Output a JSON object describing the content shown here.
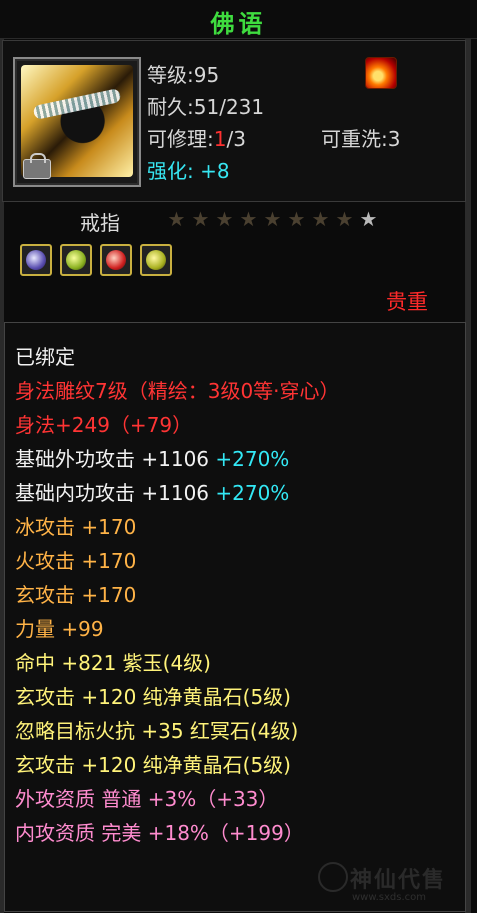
{
  "title": "佛语",
  "item": {
    "level_text": "等级:95",
    "durability_label": "耐久:",
    "durability_value": "51/231",
    "repair_label": "可修理:",
    "repair_used": "1",
    "repair_total": "/3",
    "rewash_text": "可重洗:3",
    "enhance_label": "强化:",
    "enhance_value": "+8",
    "type": "戒指",
    "stars_lit": 1,
    "stars_total": 9,
    "quality": "贵重",
    "status_icon": "fire-element-icon",
    "gem_icons": [
      "purple-gem-icon",
      "green-gem-icon",
      "red-gem-icon",
      "yellow-gem-icon"
    ]
  },
  "attributes": [
    {
      "parts": [
        {
          "text": "已绑定",
          "color": "w"
        }
      ]
    },
    {
      "parts": [
        {
          "text": "身法雕纹7级（精绘：3级0等·穿心）",
          "color": "r"
        }
      ]
    },
    {
      "parts": [
        {
          "text": "身法+249（+79）",
          "color": "r"
        }
      ]
    },
    {
      "parts": [
        {
          "text": "基础外功攻击 +1106 ",
          "color": "w"
        },
        {
          "text": "+270%",
          "color": "c"
        }
      ]
    },
    {
      "parts": [
        {
          "text": "基础内功攻击 +1106 ",
          "color": "w"
        },
        {
          "text": "+270%",
          "color": "c"
        }
      ]
    },
    {
      "parts": [
        {
          "text": "冰攻击 +170",
          "color": "o"
        }
      ]
    },
    {
      "parts": [
        {
          "text": "火攻击 +170",
          "color": "o"
        }
      ]
    },
    {
      "parts": [
        {
          "text": "玄攻击 +170",
          "color": "o"
        }
      ]
    },
    {
      "parts": [
        {
          "text": "力量 +99",
          "color": "o"
        }
      ]
    },
    {
      "parts": [
        {
          "text": "命中 +821 紫玉(4级)",
          "color": "y"
        }
      ]
    },
    {
      "parts": [
        {
          "text": "玄攻击 +120 纯净黄晶石(5级)",
          "color": "y"
        }
      ]
    },
    {
      "parts": [
        {
          "text": "忽略目标火抗 +35 红冥石(4级)",
          "color": "y"
        }
      ]
    },
    {
      "parts": [
        {
          "text": "玄攻击 +120 纯净黄晶石(5级)",
          "color": "y"
        }
      ]
    },
    {
      "parts": [
        {
          "text": "外攻资质  普通 +3%（+33）",
          "color": "p"
        }
      ]
    },
    {
      "parts": [
        {
          "text": "内攻资质  完美 +18%（+199）",
          "color": "p"
        }
      ]
    }
  ],
  "watermark": {
    "text": "神仙代售",
    "sub": "www.sxds.com"
  }
}
